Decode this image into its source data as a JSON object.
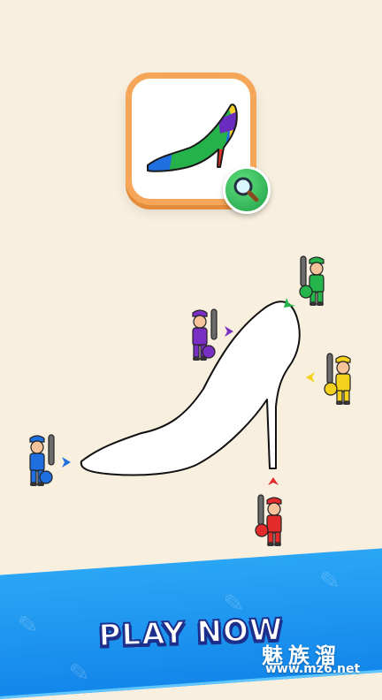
{
  "preview": {
    "icon": "high-heel-shoe-colored",
    "colors": {
      "blue": "#1f6fe0",
      "green": "#26b24a",
      "yellow": "#f5d22a",
      "purple": "#6a2bbf",
      "red": "#e0302a"
    }
  },
  "magnifier": {
    "icon": "magnifier-icon"
  },
  "outline": {
    "icon": "high-heel-shoe-outline"
  },
  "painters": [
    {
      "color_name": "blue",
      "color": "#1f6fe0"
    },
    {
      "color_name": "purple",
      "color": "#7a2fc4"
    },
    {
      "color_name": "green",
      "color": "#25b54b"
    },
    {
      "color_name": "yellow",
      "color": "#f3d11d"
    },
    {
      "color_name": "red",
      "color": "#e22b2b"
    }
  ],
  "banner": {
    "cta_label": "PLAY NOW",
    "background": "#1c8cec",
    "decor_icon": "paint-brush-icon"
  },
  "watermark": {
    "brand": "魅族溜",
    "url": "www.mz6.net"
  }
}
